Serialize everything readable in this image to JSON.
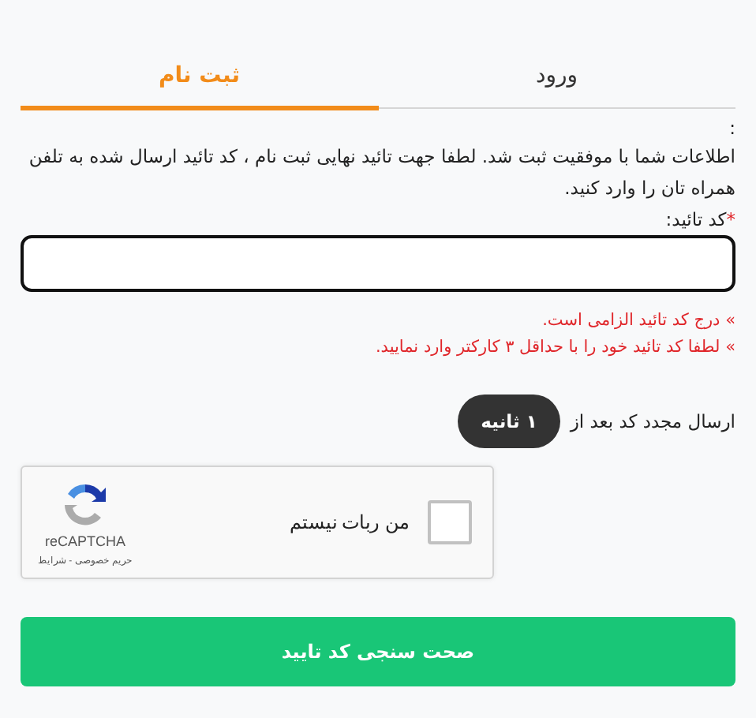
{
  "tabs": [
    {
      "label": "ورود",
      "selected": false
    },
    {
      "label": "ثبت نام",
      "selected": true
    }
  ],
  "prefix": ":",
  "message": "اطلاعات شما با موفقیت ثبت شد. لطفا جهت تائید نهایی ثبت نام ، کد تائید ارسال شده به تلفن همراه تان را وارد کنید.",
  "code_field": {
    "label": "کد تائید:",
    "required_mark": "*"
  },
  "errors": [
    "» درج کد تائید الزامی است.",
    "» لطفا کد تائید خود را با حداقل ۳ کارکتر وارد نمایید."
  ],
  "resend": {
    "label": "ارسال مجدد کد بعد از",
    "countdown": "۱ ثانیه"
  },
  "captcha": {
    "label": "من ربات نیستم",
    "checked": false,
    "brand": "reCAPTCHA",
    "links": "حریم خصوصی - شرایط"
  },
  "submit": "صحت سنجی کد تایید"
}
